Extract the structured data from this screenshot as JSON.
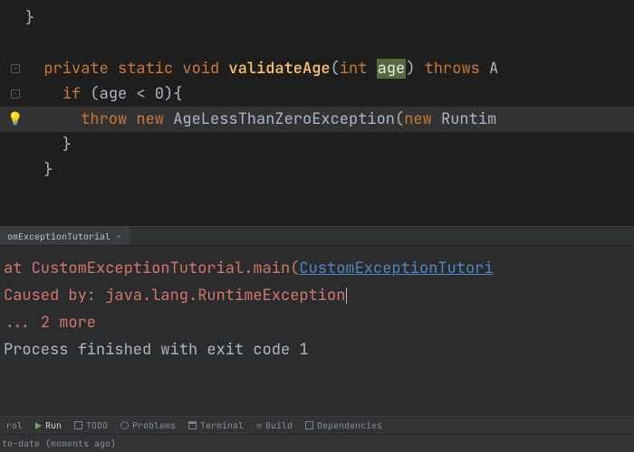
{
  "editor": {
    "lines": [
      {
        "indent": 0,
        "brace": "}"
      },
      {
        "indent": 0,
        "blank": true
      },
      {
        "indent": 1,
        "fold": true,
        "tokens": [
          {
            "cls": "kw",
            "t": "private static void "
          },
          {
            "cls": "method-name",
            "t": "validateAge"
          },
          {
            "cls": "plain",
            "t": "("
          },
          {
            "cls": "kw",
            "t": "int "
          },
          {
            "cls": "param-hi",
            "t": "age"
          },
          {
            "cls": "plain",
            "t": ") "
          },
          {
            "cls": "kw",
            "t": "throws "
          },
          {
            "cls": "type",
            "t": "A"
          }
        ]
      },
      {
        "indent": 2,
        "fold": true,
        "tokens": [
          {
            "cls": "kw",
            "t": "if "
          },
          {
            "cls": "plain",
            "t": "(age < "
          },
          {
            "cls": "plain",
            "t": "0"
          },
          {
            "cls": "plain",
            "t": "){"
          }
        ]
      },
      {
        "indent": 3,
        "active": true,
        "bulb": true,
        "tokens": [
          {
            "cls": "kw",
            "t": "throw new "
          },
          {
            "cls": "type",
            "t": "AgeLessThanZeroException("
          },
          {
            "cls": "kw",
            "t": "new "
          },
          {
            "cls": "type",
            "t": "Runtim"
          }
        ]
      },
      {
        "indent": 2,
        "brace": "}"
      },
      {
        "indent": 1,
        "brace": "}"
      },
      {
        "indent": 0,
        "blank": true
      },
      {
        "indent": 0,
        "blank": true
      }
    ]
  },
  "runTab": {
    "cut": "omExceptionTutorial",
    "close": "×"
  },
  "console": {
    "l1_pre": "   at CustomExceptionTutorial.main(",
    "l1_link": "CustomExceptionTutori",
    "l2": "Caused by: java.lang.RuntimeException",
    "l3": "   ... 2 more",
    "l_blank": "",
    "l5": "Process finished with exit code 1"
  },
  "toolbar": {
    "t1": "rol",
    "t2": "Run",
    "t3": "TODO",
    "t4": "Problems",
    "t5": "Terminal",
    "t6": "Build",
    "t7": "Dependencies"
  },
  "status": "to-date (moments ago)"
}
